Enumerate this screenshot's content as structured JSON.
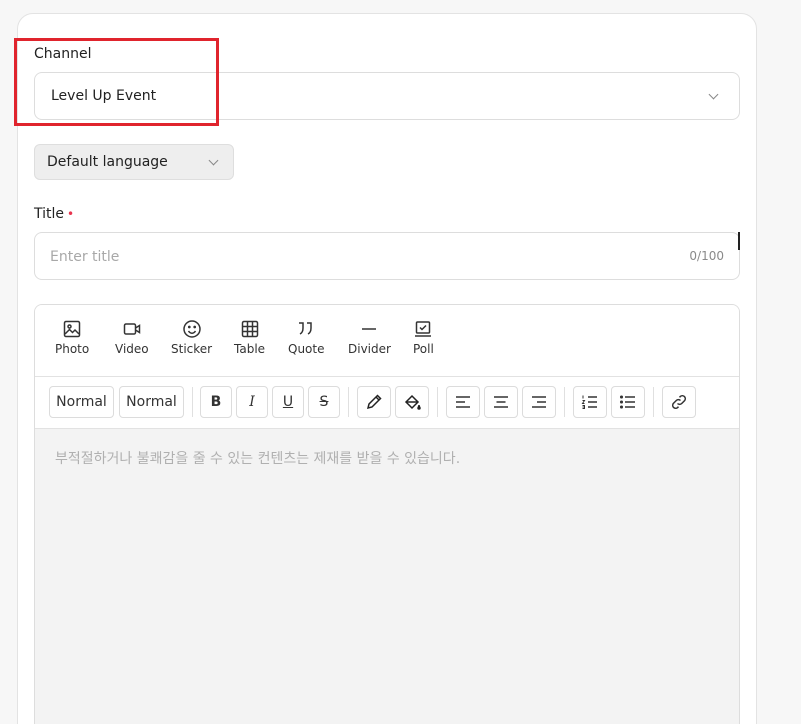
{
  "channel": {
    "label": "Channel",
    "selected": "Level Up Event"
  },
  "language": {
    "selected": "Default language"
  },
  "title": {
    "label": "Title",
    "required_mark": "•",
    "placeholder": "Enter title",
    "value": "",
    "counter": "0/100"
  },
  "editor": {
    "insert_tools": [
      {
        "label": "Photo",
        "icon": "image-icon"
      },
      {
        "label": "Video",
        "icon": "video-icon"
      },
      {
        "label": "Sticker",
        "icon": "smiley-icon"
      },
      {
        "label": "Table",
        "icon": "table-icon"
      },
      {
        "label": "Quote",
        "icon": "quote-icon"
      },
      {
        "label": "Divider",
        "icon": "divider-icon"
      },
      {
        "label": "Poll",
        "icon": "poll-icon"
      }
    ],
    "format": {
      "font_size": "Normal",
      "heading": "Normal",
      "bold": "B",
      "italic": "I",
      "underline": "U",
      "strike": "S"
    },
    "placeholder": "부적절하거나 불쾌감을 줄 수 있는 컨텐츠는 제재를 받을 수 있습니다."
  },
  "colors": {
    "highlight": "#e0242d",
    "required": "#e8344e",
    "editor_bg": "#f3f3f3"
  }
}
